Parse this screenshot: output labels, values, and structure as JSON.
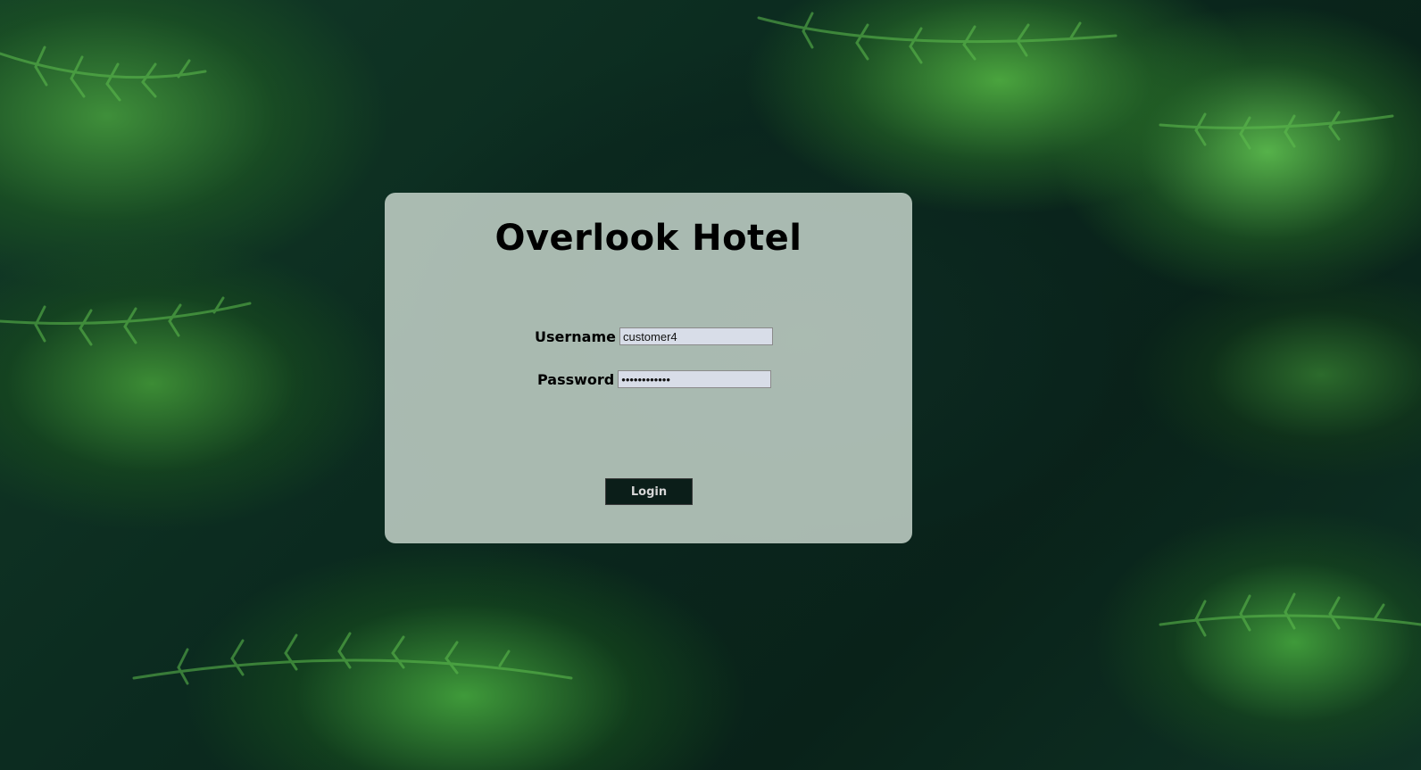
{
  "page": {
    "title": "Overlook Hotel"
  },
  "login_form": {
    "username_label": "Username",
    "username_value": "customer4",
    "password_label": "Password",
    "password_value": "overlook2021",
    "submit_label": "Login"
  },
  "colors": {
    "card_background": "#c8d7cd",
    "button_background": "#0b1e19",
    "button_text": "#d6d6d6",
    "input_background": "#d8dde8"
  }
}
